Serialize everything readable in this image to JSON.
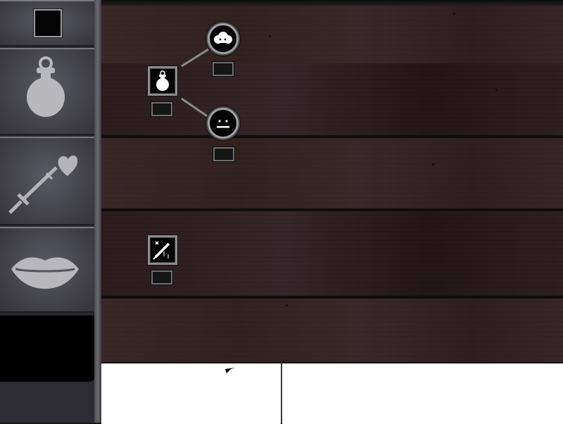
{
  "sidebar": {
    "tabs": [
      {
        "name": "square-slot"
      },
      {
        "name": "potion-flask-icon"
      },
      {
        "name": "heart-sword-icon"
      },
      {
        "name": "lips-icon"
      },
      {
        "name": "empty-slot"
      }
    ]
  },
  "skill_tree": {
    "nodes": [
      {
        "id": "potion",
        "icon": "potion-flask-icon",
        "rank": ""
      },
      {
        "id": "cloud",
        "icon": "cloud-icon",
        "rank": ""
      },
      {
        "id": "face",
        "icon": "sleeping-face-icon",
        "rank": ""
      },
      {
        "id": "blade",
        "icon": "poisoned-blade-icon",
        "rank": ""
      }
    ]
  },
  "bottom_panel": {
    "left_text": "",
    "right_text": ""
  },
  "colors": {
    "wood": "#332224",
    "plank_gap": "#120c0c",
    "frame": "#8c8c90",
    "sidebar": "#3e3e44",
    "panel": "#ffffff"
  }
}
